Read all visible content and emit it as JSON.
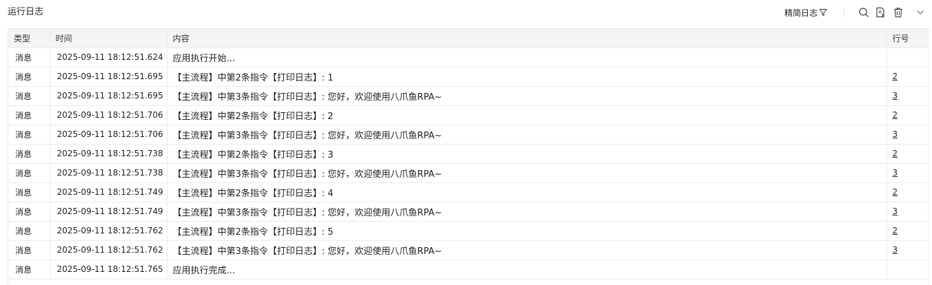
{
  "header": {
    "title": "运行日志",
    "filter_label": "精简日志"
  },
  "icons": {
    "filter": "filter-icon",
    "search": "search-icon",
    "export": "export-log-icon",
    "delete": "trash-icon",
    "collapse": "chevron-down-icon"
  },
  "table": {
    "columns": {
      "type": "类型",
      "time": "时间",
      "content": "内容",
      "line": "行号"
    },
    "rows": [
      {
        "type": "消息",
        "time": "2025-09-11 18:12:51.624",
        "content": "应用执行开始...",
        "line": ""
      },
      {
        "type": "消息",
        "time": "2025-09-11 18:12:51.695",
        "content": "【主流程】中第2条指令【打印日志】: 1",
        "line": "2"
      },
      {
        "type": "消息",
        "time": "2025-09-11 18:12:51.695",
        "content": "【主流程】中第3条指令【打印日志】: 您好，欢迎使用八爪鱼RPA~",
        "line": "3"
      },
      {
        "type": "消息",
        "time": "2025-09-11 18:12:51.706",
        "content": "【主流程】中第2条指令【打印日志】: 2",
        "line": "2"
      },
      {
        "type": "消息",
        "time": "2025-09-11 18:12:51.706",
        "content": "【主流程】中第3条指令【打印日志】: 您好，欢迎使用八爪鱼RPA~",
        "line": "3"
      },
      {
        "type": "消息",
        "time": "2025-09-11 18:12:51.738",
        "content": "【主流程】中第2条指令【打印日志】: 3",
        "line": "2"
      },
      {
        "type": "消息",
        "time": "2025-09-11 18:12:51.738",
        "content": "【主流程】中第3条指令【打印日志】: 您好，欢迎使用八爪鱼RPA~",
        "line": "3"
      },
      {
        "type": "消息",
        "time": "2025-09-11 18:12:51.749",
        "content": "【主流程】中第2条指令【打印日志】: 4",
        "line": "2"
      },
      {
        "type": "消息",
        "time": "2025-09-11 18:12:51.749",
        "content": "【主流程】中第3条指令【打印日志】: 您好，欢迎使用八爪鱼RPA~",
        "line": "3"
      },
      {
        "type": "消息",
        "time": "2025-09-11 18:12:51.762",
        "content": "【主流程】中第2条指令【打印日志】: 5",
        "line": "2"
      },
      {
        "type": "消息",
        "time": "2025-09-11 18:12:51.762",
        "content": "【主流程】中第3条指令【打印日志】: 您好，欢迎使用八爪鱼RPA~",
        "line": "3"
      },
      {
        "type": "消息",
        "time": "2025-09-11 18:12:51.765",
        "content": "应用执行完成...",
        "line": ""
      }
    ]
  }
}
